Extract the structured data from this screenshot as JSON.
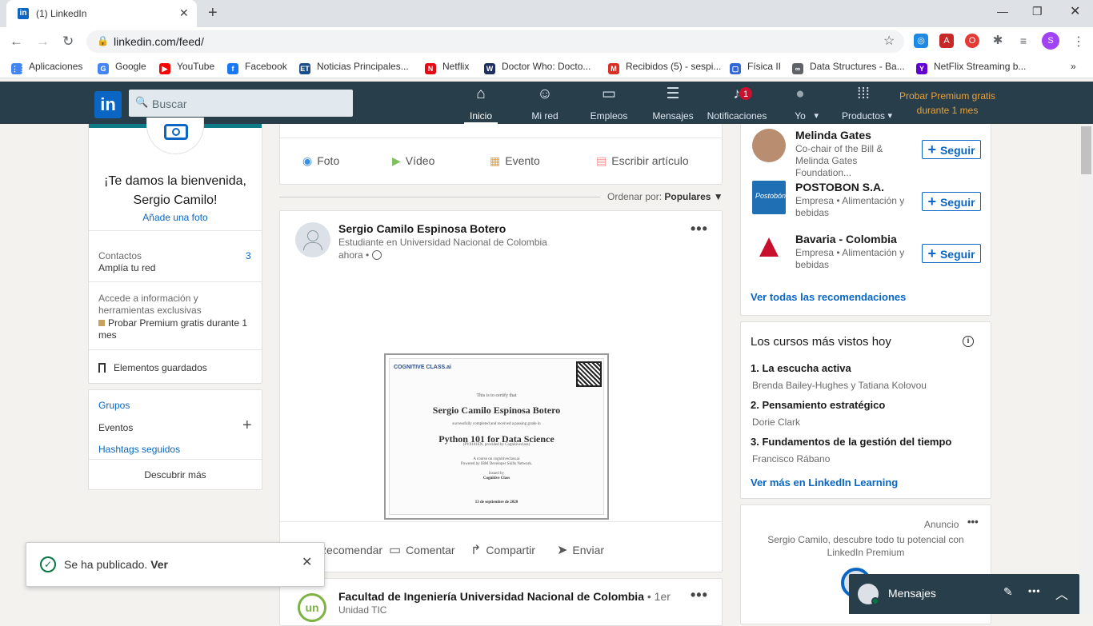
{
  "browser": {
    "tab_title": "(1) LinkedIn",
    "url": "linkedin.com/feed/",
    "bookmarks": [
      {
        "label": "Aplicaciones",
        "icon": "apps-grid-icon",
        "color": "#4285f4"
      },
      {
        "label": "Google",
        "icon": "google-icon",
        "color": "#4285f4"
      },
      {
        "label": "YouTube",
        "icon": "youtube-icon",
        "color": "#ff0000"
      },
      {
        "label": "Facebook",
        "icon": "facebook-icon",
        "color": "#1877f2"
      },
      {
        "label": "Noticias Principales...",
        "icon": "et-icon",
        "color": "#1a4e8a"
      },
      {
        "label": "Netflix",
        "icon": "netflix-icon",
        "color": "#e50914"
      },
      {
        "label": "Doctor Who: Docto...",
        "icon": "doctor-who-icon",
        "color": "#1c2f5e"
      },
      {
        "label": "Recibidos (5) - sespi...",
        "icon": "gmail-icon",
        "color": "#d93025"
      },
      {
        "label": "Física II",
        "icon": "page-icon",
        "color": "#3367d6"
      },
      {
        "label": "Data Structures - Ba...",
        "icon": "link-icon",
        "color": "#5f6368"
      },
      {
        "label": "NetFlix Streaming b...",
        "icon": "yahoo-icon",
        "color": "#6001d2"
      }
    ],
    "profile_initial": "S"
  },
  "linkedin": {
    "search_placeholder": "Buscar",
    "nav": [
      {
        "label": "Inicio",
        "icon": "home-icon",
        "active": true
      },
      {
        "label": "Mi red",
        "icon": "network-icon"
      },
      {
        "label": "Empleos",
        "icon": "briefcase-icon"
      },
      {
        "label": "Mensajes",
        "icon": "messages-icon"
      },
      {
        "label": "Notificaciones",
        "icon": "bell-icon",
        "badge": "1"
      },
      {
        "label": "Yo",
        "icon": "avatar-icon"
      },
      {
        "label": "Productos",
        "icon": "grid-icon"
      }
    ],
    "premium_line1": "Probar Premium gratis",
    "premium_line2": "durante 1 mes"
  },
  "left": {
    "welcome": "¡Te damos la bienvenida, Sergio Camilo!",
    "add_photo": "Añade una foto",
    "contacts_label": "Contactos",
    "contacts_count": "3",
    "grow_network": "Amplía tu red",
    "access_info": "Accede a información y herramientas exclusivas",
    "premium_try": "Probar Premium gratis durante 1 mes",
    "saved_items": "Elementos guardados",
    "groups": "Grupos",
    "events": "Eventos",
    "hashtags": "Hashtags seguidos",
    "discover_more": "Descubrir más"
  },
  "composer": {
    "photo": "Foto",
    "video": "Vídeo",
    "event": "Evento",
    "article": "Escribir artículo"
  },
  "sort": {
    "label": "Ordenar por:",
    "value": "Populares"
  },
  "post": {
    "author": "Sergio Camilo Espinosa Botero",
    "headline": "Estudiante en Universidad Nacional de Colombia",
    "time": "ahora •",
    "certificate": {
      "brand": "COGNITIVE CLASS.ai",
      "certify": "This is to certify that",
      "name": "Sergio Camilo Espinosa Botero",
      "completed": "successfully completed and received a passing grade in",
      "course": "Python 101 for Data Science",
      "code": "(PY0101EN, provided by Cognitiveclass)",
      "on": "A course on cognitiveclass.ai",
      "powered": "Powered by IBM Developer Skills Network.",
      "issued": "Issued by",
      "issuer": "Cognitive Class",
      "date": "13 de septiembre de 2020"
    },
    "actions": [
      "Recomendar",
      "Comentar",
      "Compartir",
      "Enviar"
    ]
  },
  "next_post": {
    "author": "Facultad de Ingeniería Universidad Nacional de Colombia",
    "degree": "• 1er",
    "headline": "Unidad TIC"
  },
  "toast": {
    "text": "Se ha publicado.",
    "link": "Ver"
  },
  "recommendations": [
    {
      "name": "Melinda Gates",
      "desc": "Co-chair of the Bill & Melinda Gates Foundation...",
      "button": "Seguir"
    },
    {
      "name": "POSTOBON S.A.",
      "desc": "Empresa • Alimentación y bebidas",
      "button": "Seguir"
    },
    {
      "name": "Bavaria - Colombia",
      "desc": "Empresa • Alimentación y bebidas",
      "button": "Seguir"
    }
  ],
  "see_all_recs": "Ver todas las recomendaciones",
  "courses": {
    "title": "Los cursos más vistos hoy",
    "items": [
      {
        "title": "1. La escucha activa",
        "author": "Brenda Bailey-Hughes y Tatiana Kolovou"
      },
      {
        "title": "2. Pensamiento estratégico",
        "author": "Dorie Clark"
      },
      {
        "title": "3. Fundamentos de la gestión del tiempo",
        "author": "Francisco Rábano"
      }
    ],
    "more": "Ver más en LinkedIn Learning"
  },
  "ad": {
    "label": "Anuncio",
    "text": "Sergio Camilo, descubre todo tu potencial con LinkedIn Premium"
  },
  "messaging": {
    "label": "Mensajes"
  }
}
